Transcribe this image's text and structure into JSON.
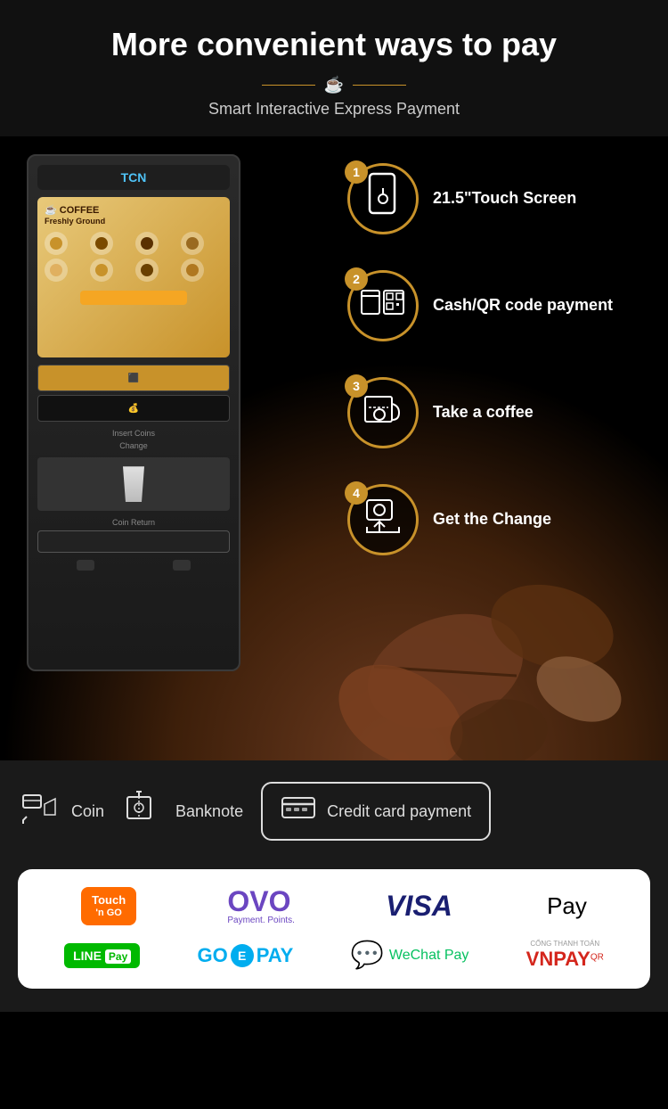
{
  "header": {
    "title": "More convenient ways to pay",
    "subtitle": "Smart Interactive Express Payment"
  },
  "steps": [
    {
      "number": "1",
      "text": "21.5\"Touch Screen"
    },
    {
      "number": "2",
      "text": "Cash/QR code payment"
    },
    {
      "number": "3",
      "text": "Take a coffee"
    },
    {
      "number": "4",
      "text": "Get the Change"
    }
  ],
  "payment_methods": {
    "coin": "Coin",
    "banknote": "Banknote",
    "credit_card": "Credit card payment"
  },
  "partners": {
    "row1": [
      "Touch 'n Go",
      "OVO",
      "VISA",
      "Apple Pay"
    ],
    "row2": [
      "LINE Pay",
      "GO-PAY",
      "WeChat Pay",
      "VNPAY QR"
    ]
  },
  "machine": {
    "brand": "TCN",
    "screen_title": "COFFEE Freshly Ground",
    "insert_label": "Insert Coins",
    "change_label": "Change",
    "coin_return_label": "Coin Return"
  }
}
